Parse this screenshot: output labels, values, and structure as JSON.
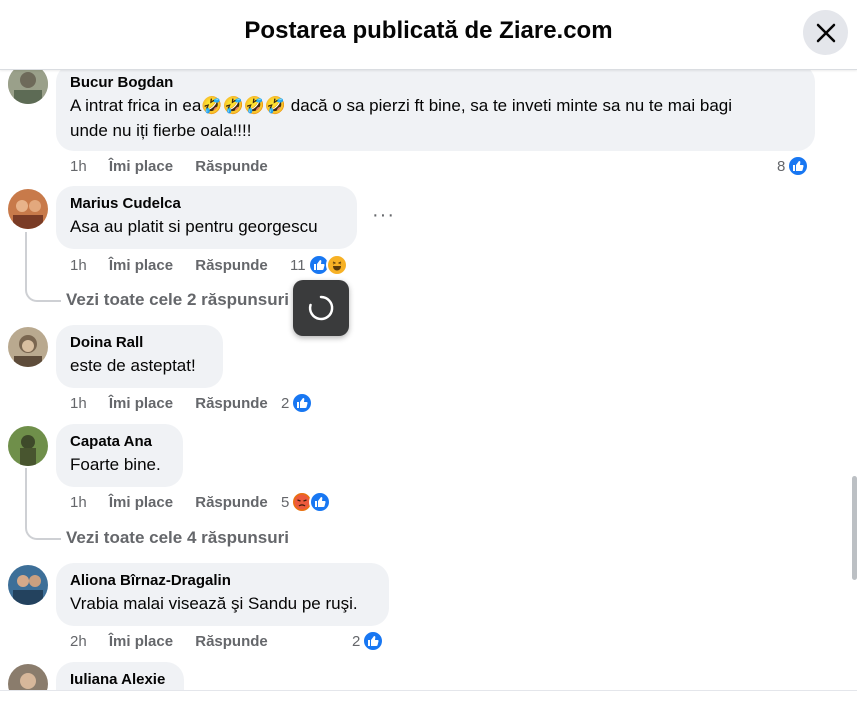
{
  "header": {
    "title": "Postarea publicată de Ziare.com"
  },
  "labels": {
    "like": "Îmi place",
    "reply": "Răspunde"
  },
  "comments": [
    {
      "author": "Bucur Bogdan",
      "text_line1": "A intrat frica in ea🤣🤣🤣🤣 dacă o sa pierzi ft bine, sa te inveti minte sa nu te mai bagi",
      "text_line2": "unde nu iți fierbe oala!!!!",
      "time": "1h",
      "reaction_count": "8",
      "reactions": [
        "like-icon"
      ]
    },
    {
      "author": "Marius Cudelca",
      "text": "Asa au platit si pentru georgescu",
      "time": "1h",
      "reaction_count": "11",
      "reactions": [
        "like-icon",
        "haha-icon"
      ],
      "view_replies": "Vezi toate cele 2 răspunsuri"
    },
    {
      "author": "Doina Rall",
      "text": "este de asteptat!",
      "time": "1h",
      "reaction_count": "2",
      "reactions": [
        "like-icon"
      ]
    },
    {
      "author": "Capata Ana",
      "text": "Foarte bine.",
      "time": "1h",
      "reaction_count": "5",
      "reactions": [
        "angry-icon",
        "like-icon"
      ],
      "view_replies": "Vezi toate cele 4 răspunsuri"
    },
    {
      "author": "Aliona Bîrnaz-Dragalin",
      "text": "Vrabia malai visează şi Sandu pe ruşi.",
      "time": "2h",
      "reaction_count": "2",
      "reactions": [
        "like-icon"
      ]
    },
    {
      "author": "Iuliana Alexie"
    }
  ],
  "more_options": "···",
  "colors": {
    "like": "#1877f2",
    "bubble": "#f0f2f5",
    "meta": "#65676b"
  }
}
